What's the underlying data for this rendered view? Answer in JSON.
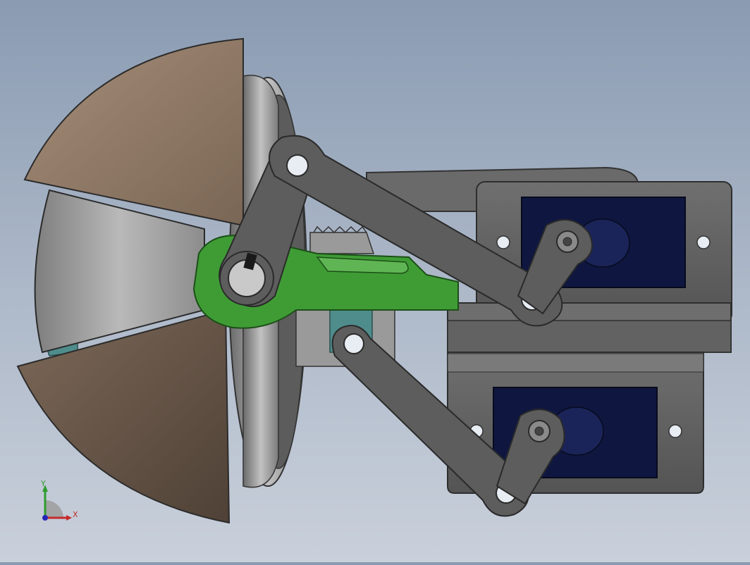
{
  "viewport": {
    "background_top": "#8a9bb2",
    "background_bottom": "#c9d0db"
  },
  "model": {
    "colors": {
      "dome": "#8c7a68",
      "steel_part": "#5d5d5d",
      "servo_body": "#0f1740",
      "green_part": "#3f9c35",
      "teal_part": "#4f8d8c"
    },
    "parts": [
      "dome-fan",
      "wheel-disc",
      "linkage-arms",
      "servo-mount-plates",
      "servo-motors",
      "green-crank",
      "gear"
    ]
  },
  "triad": {
    "x_label": "X",
    "y_label": "Y",
    "x_color": "#c42b2b",
    "y_color": "#2f9c2f",
    "z_color": "#2626b8"
  }
}
